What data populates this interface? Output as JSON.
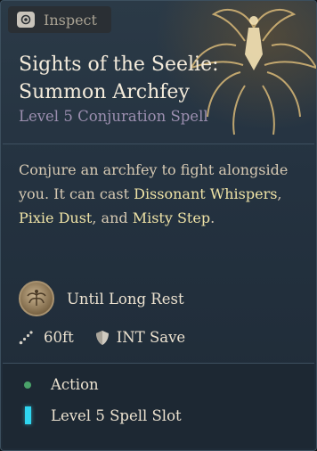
{
  "inspect": {
    "label": "Inspect",
    "key_icon": "mouse-button-icon"
  },
  "spell": {
    "title_line1": "Sights of the Seelie:",
    "title_line2": "Summon Archfey",
    "subtitle": "Level 5 Conjuration Spell",
    "description": {
      "intro": "Conjure an archfey to fight alongside you. It can cast ",
      "ref1": "Dissonant Whispers",
      "sep1": ", ",
      "ref2": "Pixie Dust",
      "sep2": ", and ",
      "ref3": "Misty Step",
      "end": "."
    },
    "duration": {
      "text": "Until Long Rest",
      "icon": "archfey-medallion-icon"
    },
    "range": {
      "text": "60ft",
      "icon": "range-icon"
    },
    "save": {
      "text": "INT Save",
      "icon": "save-shield-icon"
    },
    "costs": [
      {
        "text": "Action",
        "icon": "action-dot-icon",
        "color": "#4aa36a"
      },
      {
        "text": "Level 5 Spell Slot",
        "icon": "spell-slot-icon",
        "color": "#2fd6f0"
      }
    ]
  },
  "colors": {
    "title": "#f4ebdb",
    "subtitle": "#9c8fb0",
    "spell_reference": "#efe3a6",
    "panel": "#243240"
  }
}
